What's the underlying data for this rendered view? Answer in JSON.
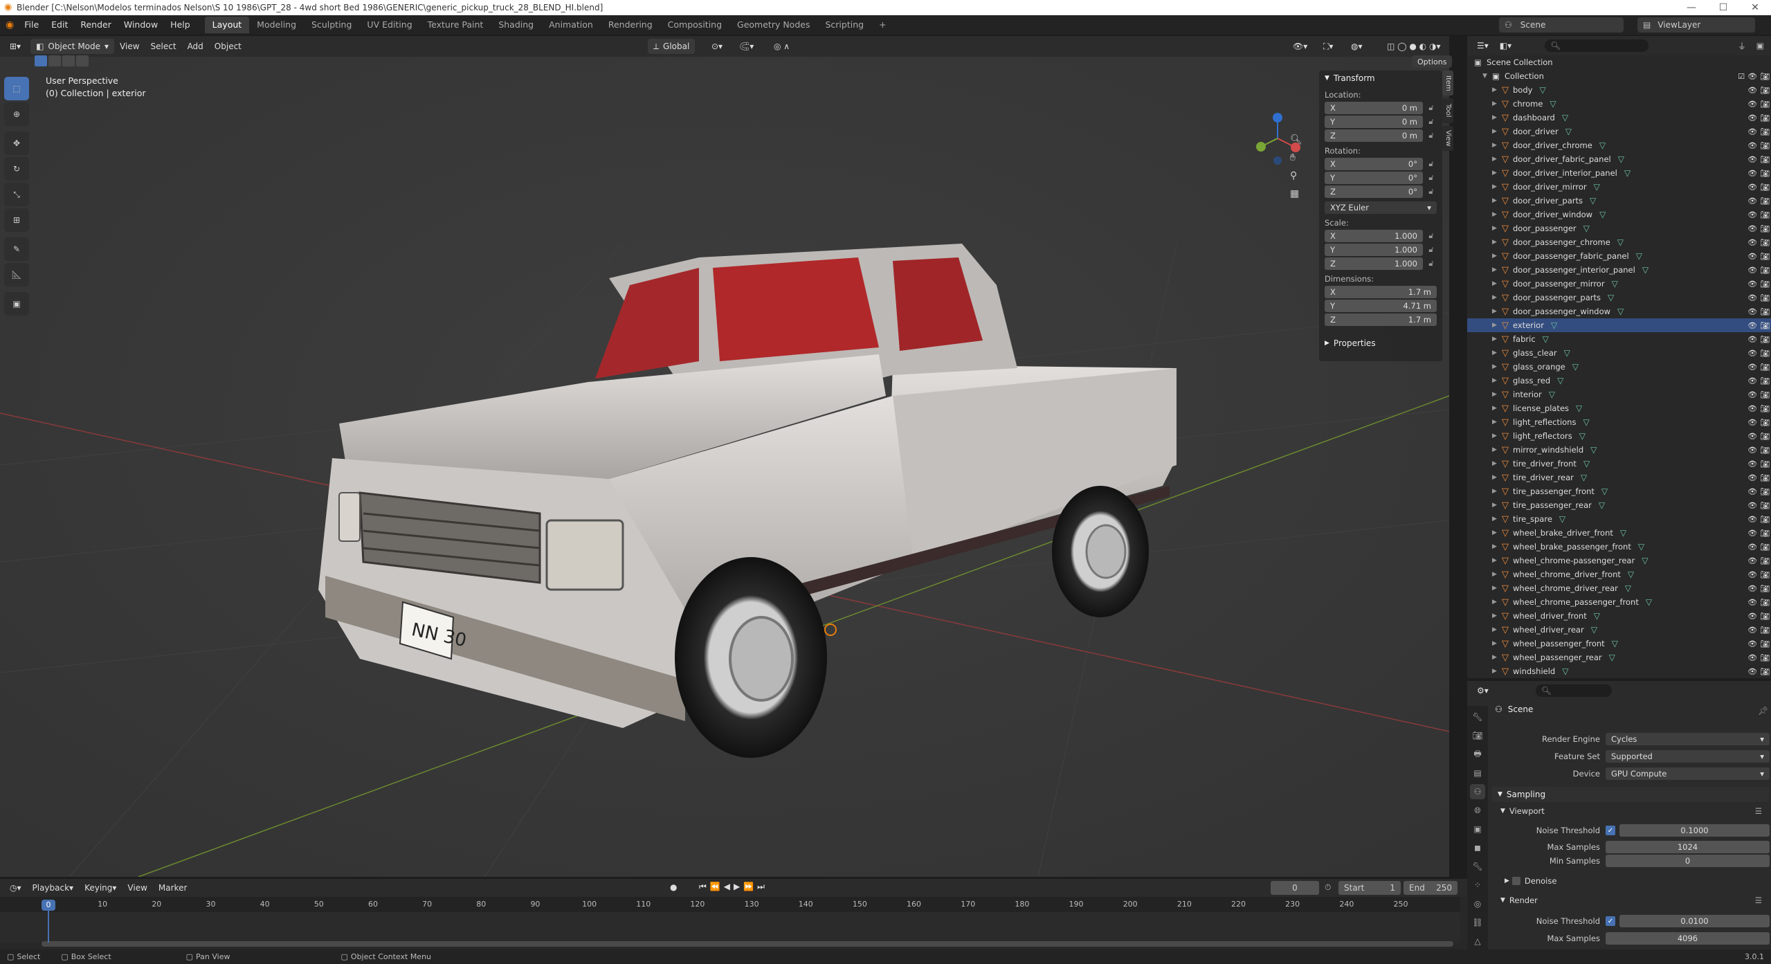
{
  "window": {
    "title": "Blender [C:\\Nelson\\Modelos terminados Nelson\\S 10 1986\\GPT_28 - 4wd short Bed 1986\\GENERIC\\generic_pickup_truck_28_BLEND_HI.blend]"
  },
  "menus": [
    "File",
    "Edit",
    "Render",
    "Window",
    "Help"
  ],
  "workspaces": [
    "Layout",
    "Modeling",
    "Sculpting",
    "UV Editing",
    "Texture Paint",
    "Shading",
    "Animation",
    "Rendering",
    "Compositing",
    "Geometry Nodes",
    "Scripting",
    "+"
  ],
  "scene": {
    "name": "Scene",
    "view_layer": "ViewLayer"
  },
  "viewport": {
    "mode": "Object Mode",
    "menu": [
      "View",
      "Select",
      "Add",
      "Object"
    ],
    "orientation": "Global",
    "options": "Options",
    "info_line1": "User Perspective",
    "info_line2": "(0) Collection | exterior",
    "plate_text": "NN 30",
    "colors": {
      "body": "#c9c5c2",
      "interior": "#b0282a",
      "grid_x": "#8a3a3a",
      "grid_y": "#6b8a2f"
    }
  },
  "npanel": {
    "header": "Transform",
    "location_label": "Location:",
    "location": [
      {
        "axis": "X",
        "value": "0 m"
      },
      {
        "axis": "Y",
        "value": "0 m"
      },
      {
        "axis": "Z",
        "value": "0 m"
      }
    ],
    "rotation_label": "Rotation:",
    "rotation": [
      {
        "axis": "X",
        "value": "0°"
      },
      {
        "axis": "Y",
        "value": "0°"
      },
      {
        "axis": "Z",
        "value": "0°"
      }
    ],
    "rotation_mode": "XYZ Euler",
    "scale_label": "Scale:",
    "scale": [
      {
        "axis": "X",
        "value": "1.000"
      },
      {
        "axis": "Y",
        "value": "1.000"
      },
      {
        "axis": "Z",
        "value": "1.000"
      }
    ],
    "dimensions_label": "Dimensions:",
    "dimensions": [
      {
        "axis": "X",
        "value": "1.7 m"
      },
      {
        "axis": "Y",
        "value": "4.71 m"
      },
      {
        "axis": "Z",
        "value": "1.7 m"
      }
    ],
    "properties": "Properties",
    "tabs": [
      "Item",
      "Tool",
      "View"
    ]
  },
  "outliner": {
    "scene_collection": "Scene Collection",
    "collection": "Collection",
    "items": [
      "body",
      "chrome",
      "dashboard",
      "door_driver",
      "door_driver_chrome",
      "door_driver_fabric_panel",
      "door_driver_interior_panel",
      "door_driver_mirror",
      "door_driver_parts",
      "door_driver_window",
      "door_passenger",
      "door_passenger_chrome",
      "door_passenger_fabric_panel",
      "door_passenger_interior_panel",
      "door_passenger_mirror",
      "door_passenger_parts",
      "door_passenger_window",
      "exterior",
      "fabric",
      "glass_clear",
      "glass_orange",
      "glass_red",
      "interior",
      "license_plates",
      "light_reflections",
      "light_reflectors",
      "mirror_windshield",
      "tire_driver_front",
      "tire_driver_rear",
      "tire_passenger_front",
      "tire_passenger_rear",
      "tire_spare",
      "wheel_brake_driver_front",
      "wheel_brake_passenger_front",
      "wheel_chrome-passenger_rear",
      "wheel_chrome_driver_front",
      "wheel_chrome_driver_rear",
      "wheel_chrome_passenger_front",
      "wheel_driver_front",
      "wheel_driver_rear",
      "wheel_passenger_front",
      "wheel_passenger_rear",
      "windshield"
    ]
  },
  "properties": {
    "context": "Scene",
    "render_engine_label": "Render Engine",
    "render_engine": "Cycles",
    "feature_set_label": "Feature Set",
    "feature_set": "Supported",
    "device_label": "Device",
    "device": "GPU Compute",
    "sampling": "Sampling",
    "viewport": "Viewport",
    "vp_noise_label": "Noise Threshold",
    "vp_noise": "0.1000",
    "vp_max_label": "Max Samples",
    "vp_max": "1024",
    "vp_min_label": "Min Samples",
    "vp_min": "0",
    "denoise": "Denoise",
    "render": "Render",
    "r_noise_label": "Noise Threshold",
    "r_noise": "0.0100",
    "r_max_label": "Max Samples",
    "r_max": "4096"
  },
  "timeline": {
    "menu": [
      "Playback",
      "Keying",
      "View",
      "Marker"
    ],
    "current_frame": "0",
    "start_label": "Start",
    "start": "1",
    "end_label": "End",
    "end": "250",
    "ticks": [
      "0",
      "10",
      "20",
      "30",
      "40",
      "50",
      "60",
      "70",
      "80",
      "90",
      "100",
      "110",
      "120",
      "130",
      "140",
      "150",
      "160",
      "170",
      "180",
      "190",
      "200",
      "210",
      "220",
      "230",
      "240",
      "250"
    ]
  },
  "status": {
    "select": "Select",
    "box_select": "Box Select",
    "pan_view": "Pan View",
    "context_menu": "Object Context Menu",
    "version": "3.0.1"
  }
}
